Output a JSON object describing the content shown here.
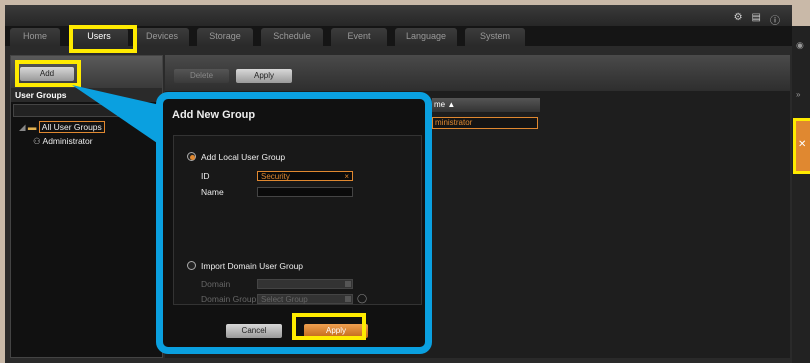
{
  "top_icons": [
    "gear-icon",
    "document-icon",
    "info-icon"
  ],
  "nav": {
    "tabs": [
      "Home",
      "Users",
      "Devices",
      "Storage",
      "Schedule",
      "Event",
      "Language",
      "System"
    ],
    "active": "Users"
  },
  "left_panel": {
    "add_label": "Add",
    "title": "User Groups",
    "tree": [
      {
        "label": "All User Groups",
        "icon": "folder-icon"
      },
      {
        "label": "Administrator",
        "icon": "users-icon"
      }
    ]
  },
  "toolbar": {
    "delete_label": "Delete",
    "apply_label": "Apply"
  },
  "grid": {
    "header": "me ▲",
    "cell": "ministrator"
  },
  "dialog": {
    "title": "Add New Group",
    "local_option": "Add Local User Group",
    "id_label": "ID",
    "id_value": "Security",
    "name_label": "Name",
    "name_value": "",
    "domain_option": "Import Domain User Group",
    "domain_label": "Domain",
    "domain_group_label": "Domain Group",
    "domain_group_placeholder": "Select Group",
    "cancel_label": "Cancel",
    "apply_label": "Apply"
  },
  "colors": {
    "accent": "#e08830",
    "highlight": "#ffeb00",
    "callout": "#0aa0e0"
  }
}
